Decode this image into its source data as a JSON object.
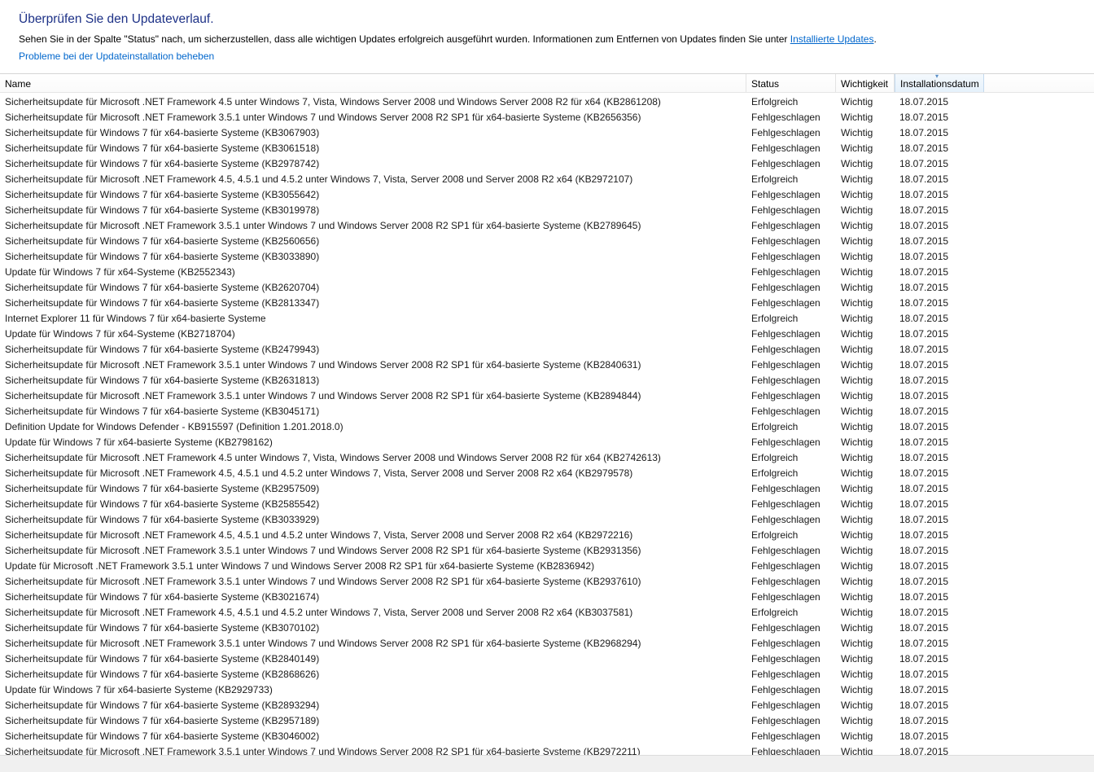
{
  "header": {
    "title": "Überprüfen Sie den Updateverlauf.",
    "description": "Sehen Sie in der Spalte \"Status\" nach, um sicherzustellen, dass alle wichtigen Updates erfolgreich ausgeführt wurden. Informationen zum Entfernen von Updates finden Sie unter ",
    "installed_link": "Installierte Updates",
    "description_end": ".",
    "fix_link": "Probleme bei der Updateinstallation beheben"
  },
  "columns": {
    "name": "Name",
    "status": "Status",
    "importance": "Wichtigkeit",
    "date": "Installationsdatum",
    "sort_icon": "sort-descending-icon"
  },
  "updates": [
    {
      "name": "Sicherheitsupdate für Microsoft .NET Framework 4.5 unter Windows 7, Vista, Windows Server 2008 und Windows Server 2008 R2 für x64 (KB2861208)",
      "status": "Erfolgreich",
      "importance": "Wichtig",
      "date": "18.07.2015"
    },
    {
      "name": "Sicherheitsupdate für Microsoft .NET Framework 3.5.1 unter Windows 7 und Windows Server 2008 R2 SP1 für x64-basierte Systeme (KB2656356)",
      "status": "Fehlgeschlagen",
      "importance": "Wichtig",
      "date": "18.07.2015"
    },
    {
      "name": "Sicherheitsupdate für Windows 7 für x64-basierte Systeme (KB3067903)",
      "status": "Fehlgeschlagen",
      "importance": "Wichtig",
      "date": "18.07.2015"
    },
    {
      "name": "Sicherheitsupdate für Windows 7 für x64-basierte Systeme (KB3061518)",
      "status": "Fehlgeschlagen",
      "importance": "Wichtig",
      "date": "18.07.2015"
    },
    {
      "name": "Sicherheitsupdate für Windows 7 für x64-basierte Systeme (KB2978742)",
      "status": "Fehlgeschlagen",
      "importance": "Wichtig",
      "date": "18.07.2015"
    },
    {
      "name": "Sicherheitsupdate für Microsoft .NET Framework 4.5, 4.5.1 und 4.5.2 unter Windows 7, Vista, Server 2008 und Server 2008 R2 x64 (KB2972107)",
      "status": "Erfolgreich",
      "importance": "Wichtig",
      "date": "18.07.2015"
    },
    {
      "name": "Sicherheitsupdate für Windows 7 für x64-basierte Systeme (KB3055642)",
      "status": "Fehlgeschlagen",
      "importance": "Wichtig",
      "date": "18.07.2015"
    },
    {
      "name": "Sicherheitsupdate für Windows 7 für x64-basierte Systeme (KB3019978)",
      "status": "Fehlgeschlagen",
      "importance": "Wichtig",
      "date": "18.07.2015"
    },
    {
      "name": "Sicherheitsupdate für Microsoft .NET Framework 3.5.1 unter Windows 7 und Windows Server 2008 R2 SP1 für x64-basierte Systeme (KB2789645)",
      "status": "Fehlgeschlagen",
      "importance": "Wichtig",
      "date": "18.07.2015"
    },
    {
      "name": "Sicherheitsupdate für Windows 7 für x64-basierte Systeme (KB2560656)",
      "status": "Fehlgeschlagen",
      "importance": "Wichtig",
      "date": "18.07.2015"
    },
    {
      "name": "Sicherheitsupdate für Windows 7 für x64-basierte Systeme (KB3033890)",
      "status": "Fehlgeschlagen",
      "importance": "Wichtig",
      "date": "18.07.2015"
    },
    {
      "name": "Update für Windows 7 für x64-Systeme (KB2552343)",
      "status": "Fehlgeschlagen",
      "importance": "Wichtig",
      "date": "18.07.2015"
    },
    {
      "name": "Sicherheitsupdate für Windows 7 für x64-basierte Systeme (KB2620704)",
      "status": "Fehlgeschlagen",
      "importance": "Wichtig",
      "date": "18.07.2015"
    },
    {
      "name": "Sicherheitsupdate für Windows 7 für x64-basierte Systeme (KB2813347)",
      "status": "Fehlgeschlagen",
      "importance": "Wichtig",
      "date": "18.07.2015"
    },
    {
      "name": "Internet Explorer 11 für Windows 7 für x64-basierte Systeme",
      "status": "Erfolgreich",
      "importance": "Wichtig",
      "date": "18.07.2015"
    },
    {
      "name": "Update für Windows 7 für x64-Systeme (KB2718704)",
      "status": "Fehlgeschlagen",
      "importance": "Wichtig",
      "date": "18.07.2015"
    },
    {
      "name": "Sicherheitsupdate für Windows 7 für x64-basierte Systeme (KB2479943)",
      "status": "Fehlgeschlagen",
      "importance": "Wichtig",
      "date": "18.07.2015"
    },
    {
      "name": "Sicherheitsupdate für Microsoft .NET Framework 3.5.1 unter Windows 7 und Windows Server 2008 R2 SP1 für x64-basierte Systeme (KB2840631)",
      "status": "Fehlgeschlagen",
      "importance": "Wichtig",
      "date": "18.07.2015"
    },
    {
      "name": "Sicherheitsupdate für Windows 7 für x64-basierte Systeme (KB2631813)",
      "status": "Fehlgeschlagen",
      "importance": "Wichtig",
      "date": "18.07.2015"
    },
    {
      "name": "Sicherheitsupdate für Microsoft .NET Framework 3.5.1 unter Windows 7 und Windows Server 2008 R2 SP1 für x64-basierte Systeme (KB2894844)",
      "status": "Fehlgeschlagen",
      "importance": "Wichtig",
      "date": "18.07.2015"
    },
    {
      "name": "Sicherheitsupdate für Windows 7 für x64-basierte Systeme (KB3045171)",
      "status": "Fehlgeschlagen",
      "importance": "Wichtig",
      "date": "18.07.2015"
    },
    {
      "name": "Definition Update for Windows Defender - KB915597 (Definition 1.201.2018.0)",
      "status": "Erfolgreich",
      "importance": "Wichtig",
      "date": "18.07.2015"
    },
    {
      "name": "Update für Windows 7 für x64-basierte Systeme (KB2798162)",
      "status": "Fehlgeschlagen",
      "importance": "Wichtig",
      "date": "18.07.2015"
    },
    {
      "name": "Sicherheitsupdate für Microsoft .NET Framework 4.5 unter Windows 7, Vista, Windows Server 2008 und Windows Server 2008 R2 für x64 (KB2742613)",
      "status": "Erfolgreich",
      "importance": "Wichtig",
      "date": "18.07.2015"
    },
    {
      "name": "Sicherheitsupdate für Microsoft .NET Framework 4.5, 4.5.1 und 4.5.2 unter Windows 7, Vista, Server 2008 und Server 2008 R2 x64 (KB2979578)",
      "status": "Erfolgreich",
      "importance": "Wichtig",
      "date": "18.07.2015"
    },
    {
      "name": "Sicherheitsupdate für Windows 7 für x64-basierte Systeme (KB2957509)",
      "status": "Fehlgeschlagen",
      "importance": "Wichtig",
      "date": "18.07.2015"
    },
    {
      "name": "Sicherheitsupdate für Windows 7 für x64-basierte Systeme (KB2585542)",
      "status": "Fehlgeschlagen",
      "importance": "Wichtig",
      "date": "18.07.2015"
    },
    {
      "name": "Sicherheitsupdate für Windows 7 für x64-basierte Systeme (KB3033929)",
      "status": "Fehlgeschlagen",
      "importance": "Wichtig",
      "date": "18.07.2015"
    },
    {
      "name": "Sicherheitsupdate für Microsoft .NET Framework 4.5, 4.5.1 und 4.5.2 unter Windows 7, Vista, Server 2008 und Server 2008 R2 x64 (KB2972216)",
      "status": "Erfolgreich",
      "importance": "Wichtig",
      "date": "18.07.2015"
    },
    {
      "name": "Sicherheitsupdate für Microsoft .NET Framework 3.5.1 unter Windows 7 und Windows Server 2008 R2 SP1 für x64-basierte Systeme (KB2931356)",
      "status": "Fehlgeschlagen",
      "importance": "Wichtig",
      "date": "18.07.2015"
    },
    {
      "name": "Update für Microsoft .NET Framework 3.5.1 unter Windows 7 und Windows Server 2008 R2 SP1 für x64-basierte Systeme (KB2836942)",
      "status": "Fehlgeschlagen",
      "importance": "Wichtig",
      "date": "18.07.2015"
    },
    {
      "name": "Sicherheitsupdate für Microsoft .NET Framework 3.5.1 unter Windows 7 und Windows Server 2008 R2 SP1 für x64-basierte Systeme (KB2937610)",
      "status": "Fehlgeschlagen",
      "importance": "Wichtig",
      "date": "18.07.2015"
    },
    {
      "name": "Sicherheitsupdate für Windows 7 für x64-basierte Systeme (KB3021674)",
      "status": "Fehlgeschlagen",
      "importance": "Wichtig",
      "date": "18.07.2015"
    },
    {
      "name": "Sicherheitsupdate für Microsoft .NET Framework 4.5, 4.5.1 und 4.5.2 unter Windows 7, Vista, Server 2008 und Server 2008 R2 x64 (KB3037581)",
      "status": "Erfolgreich",
      "importance": "Wichtig",
      "date": "18.07.2015"
    },
    {
      "name": "Sicherheitsupdate für Windows 7 für x64-basierte Systeme (KB3070102)",
      "status": "Fehlgeschlagen",
      "importance": "Wichtig",
      "date": "18.07.2015"
    },
    {
      "name": "Sicherheitsupdate für Microsoft .NET Framework 3.5.1 unter Windows 7 und Windows Server 2008 R2 SP1 für x64-basierte Systeme (KB2968294)",
      "status": "Fehlgeschlagen",
      "importance": "Wichtig",
      "date": "18.07.2015"
    },
    {
      "name": "Sicherheitsupdate für Windows 7 für x64-basierte Systeme (KB2840149)",
      "status": "Fehlgeschlagen",
      "importance": "Wichtig",
      "date": "18.07.2015"
    },
    {
      "name": "Sicherheitsupdate für Windows 7 für x64-basierte Systeme (KB2868626)",
      "status": "Fehlgeschlagen",
      "importance": "Wichtig",
      "date": "18.07.2015"
    },
    {
      "name": "Update für Windows 7 für x64-basierte Systeme (KB2929733)",
      "status": "Fehlgeschlagen",
      "importance": "Wichtig",
      "date": "18.07.2015"
    },
    {
      "name": "Sicherheitsupdate für Windows 7 für x64-basierte Systeme (KB2893294)",
      "status": "Fehlgeschlagen",
      "importance": "Wichtig",
      "date": "18.07.2015"
    },
    {
      "name": "Sicherheitsupdate für Windows 7 für x64-basierte Systeme (KB2957189)",
      "status": "Fehlgeschlagen",
      "importance": "Wichtig",
      "date": "18.07.2015"
    },
    {
      "name": "Sicherheitsupdate für Windows 7 für x64-basierte Systeme (KB3046002)",
      "status": "Fehlgeschlagen",
      "importance": "Wichtig",
      "date": "18.07.2015"
    },
    {
      "name": "Sicherheitsupdate für Microsoft .NET Framework 3.5.1 unter Windows 7 und Windows Server 2008 R2 SP1 für x64-basierte Systeme (KB2972211)",
      "status": "Fehlgeschlagen",
      "importance": "Wichtig",
      "date": "18.07.2015"
    }
  ]
}
